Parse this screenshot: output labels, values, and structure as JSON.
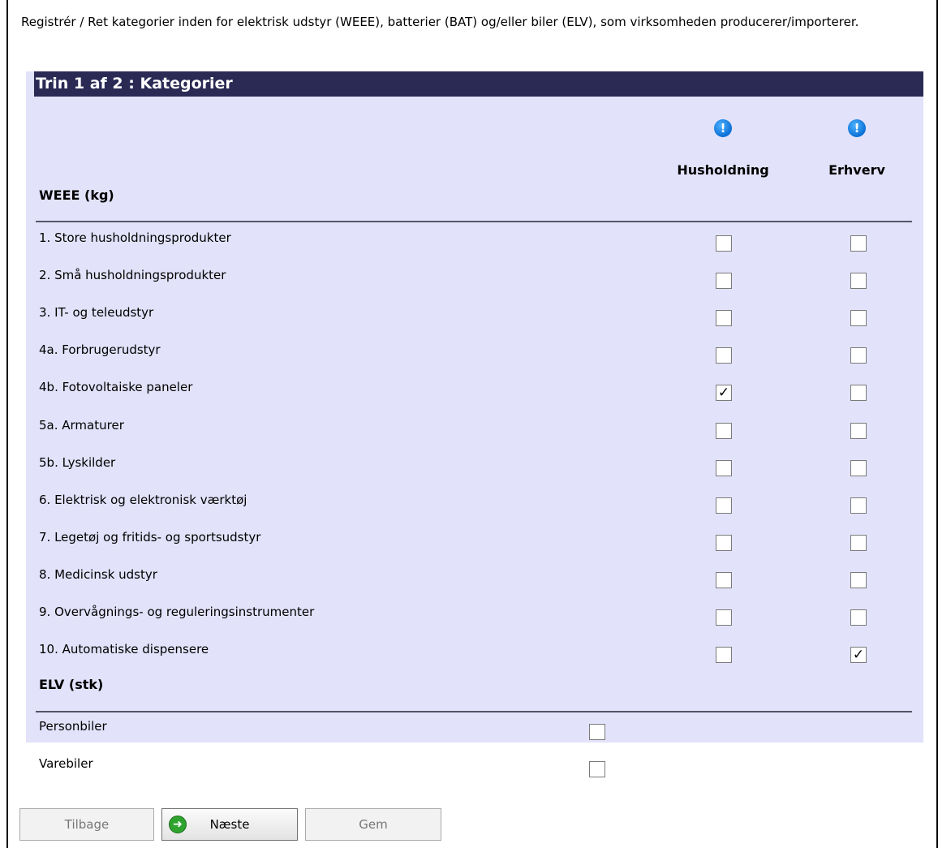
{
  "intro_text": "Registrér / Ret kategorier inden for elektrisk udstyr (WEEE), batterier (BAT) og/eller biler (ELV), som virksomheden producerer/importerer.",
  "panel": {
    "header": "Trin 1 af 2 : Kategorier",
    "columns": {
      "household": "Husholdning",
      "business": "Erhverv"
    },
    "info_icon_glyph": "!",
    "weee": {
      "title": "WEEE (kg)",
      "rows": [
        {
          "label": "1. Store husholdningsprodukter",
          "household": false,
          "business": false
        },
        {
          "label": "2. Små husholdningsprodukter",
          "household": false,
          "business": false
        },
        {
          "label": "3. IT- og teleudstyr",
          "household": false,
          "business": false
        },
        {
          "label": "4a. Forbrugerudstyr",
          "household": false,
          "business": false
        },
        {
          "label": "4b. Fotovoltaiske paneler",
          "household": true,
          "business": false
        },
        {
          "label": "5a. Armaturer",
          "household": false,
          "business": false
        },
        {
          "label": "5b. Lyskilder",
          "household": false,
          "business": false
        },
        {
          "label": "6. Elektrisk og elektronisk værktøj",
          "household": false,
          "business": false
        },
        {
          "label": "7. Legetøj og fritids- og sportsudstyr",
          "household": false,
          "business": false
        },
        {
          "label": "8. Medicinsk udstyr",
          "household": false,
          "business": false
        },
        {
          "label": "9. Overvågnings- og reguleringsinstrumenter",
          "household": false,
          "business": false
        },
        {
          "label": "10. Automatiske dispensere",
          "household": false,
          "business": true
        }
      ]
    },
    "elv": {
      "title": "ELV (stk)",
      "rows": [
        {
          "label": "Personbiler",
          "checked": false
        },
        {
          "label": "Varebiler",
          "checked": false
        }
      ]
    }
  },
  "buttons": {
    "back": "Tilbage",
    "next": "Næste",
    "save": "Gem"
  },
  "check_glyph": "✓",
  "arrow_glyph": "➜",
  "colors": {
    "header_bg": "#2a2a55",
    "panel_bg": "#e2e2fa"
  }
}
